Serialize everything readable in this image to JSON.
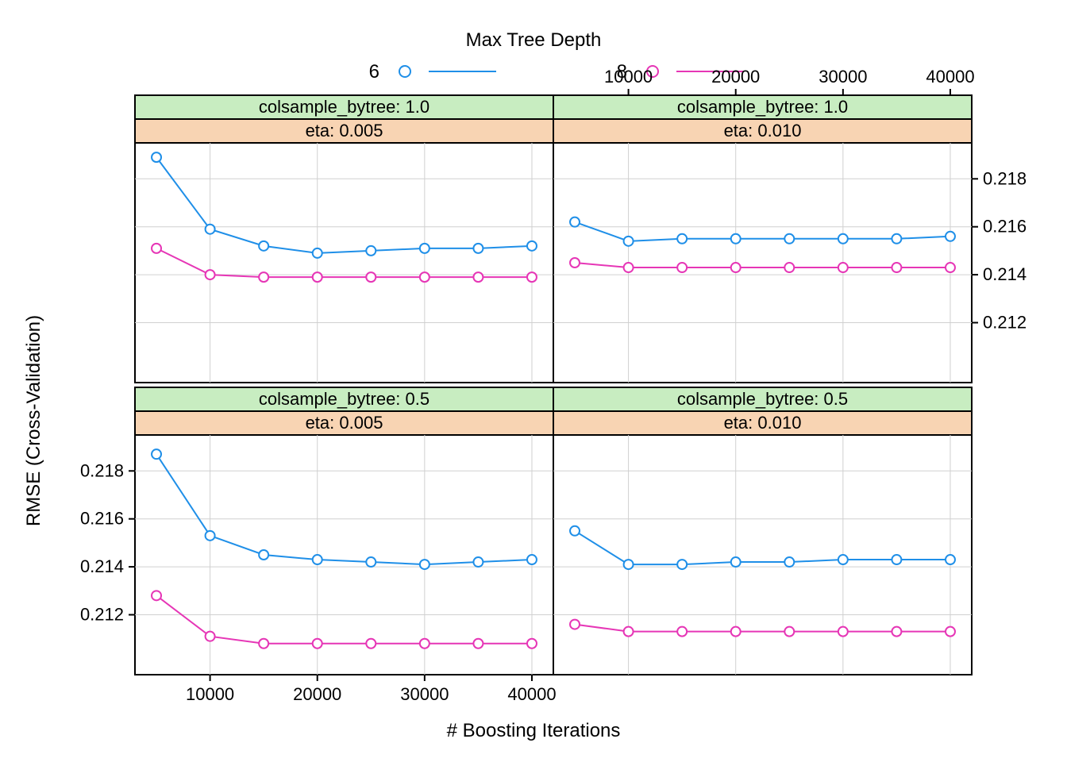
{
  "chart_data": {
    "type": "line",
    "legend_title": "Max Tree Depth",
    "legend_entries": [
      "6",
      "8"
    ],
    "xlabel": "# Boosting Iterations",
    "ylabel": "RMSE (Cross-Validation)",
    "x": [
      5000,
      10000,
      15000,
      20000,
      25000,
      30000,
      35000,
      40000
    ],
    "xlim": [
      3000,
      42000
    ],
    "ylim": [
      0.2095,
      0.2195
    ],
    "x_ticks": [
      10000,
      20000,
      30000,
      40000
    ],
    "y_ticks": [
      0.212,
      0.214,
      0.216,
      0.218
    ],
    "panels": [
      {
        "row": 0,
        "col": 0,
        "strips": [
          "colsample_bytree: 1.0",
          "eta: 0.005"
        ],
        "series": [
          {
            "name": "6",
            "values": [
              0.2189,
              0.2159,
              0.2152,
              0.2149,
              0.215,
              0.2151,
              0.2151,
              0.2152
            ]
          },
          {
            "name": "8",
            "values": [
              0.2151,
              0.214,
              0.2139,
              0.2139,
              0.2139,
              0.2139,
              0.2139,
              0.2139
            ]
          }
        ]
      },
      {
        "row": 0,
        "col": 1,
        "strips": [
          "colsample_bytree: 1.0",
          "eta: 0.010"
        ],
        "series": [
          {
            "name": "6",
            "values": [
              0.2162,
              0.2154,
              0.2155,
              0.2155,
              0.2155,
              0.2155,
              0.2155,
              0.2156
            ]
          },
          {
            "name": "8",
            "values": [
              0.2145,
              0.2143,
              0.2143,
              0.2143,
              0.2143,
              0.2143,
              0.2143,
              0.2143
            ]
          }
        ]
      },
      {
        "row": 1,
        "col": 0,
        "strips": [
          "colsample_bytree: 0.5",
          "eta: 0.005"
        ],
        "series": [
          {
            "name": "6",
            "values": [
              0.2187,
              0.2153,
              0.2145,
              0.2143,
              0.2142,
              0.2141,
              0.2142,
              0.2143
            ]
          },
          {
            "name": "8",
            "values": [
              0.2128,
              0.2111,
              0.2108,
              0.2108,
              0.2108,
              0.2108,
              0.2108,
              0.2108
            ]
          }
        ]
      },
      {
        "row": 1,
        "col": 1,
        "strips": [
          "colsample_bytree: 0.5",
          "eta: 0.010"
        ],
        "series": [
          {
            "name": "6",
            "values": [
              0.2155,
              0.2141,
              0.2141,
              0.2142,
              0.2142,
              0.2143,
              0.2143,
              0.2143
            ]
          },
          {
            "name": "8",
            "values": [
              0.2116,
              0.2113,
              0.2113,
              0.2113,
              0.2113,
              0.2113,
              0.2113,
              0.2113
            ]
          }
        ]
      }
    ]
  },
  "colors": {
    "series_6": "#1f8fe8",
    "series_8": "#e636b6",
    "strip_green": "#c8edc1",
    "strip_orange": "#f8d4b3"
  }
}
